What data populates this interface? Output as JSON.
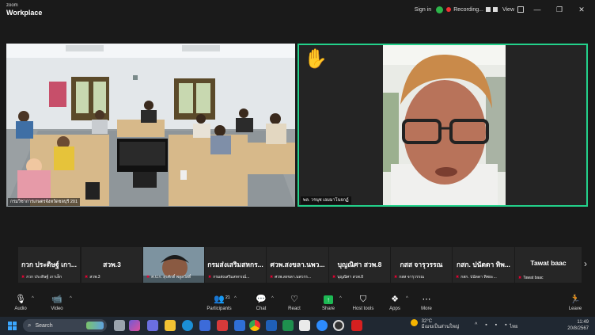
{
  "app": {
    "brand_line1": "zoom",
    "brand_line2": "Workplace"
  },
  "titlebar": {
    "signin": "Sign in",
    "recording": "Recording...",
    "view": "View"
  },
  "colors": {
    "active_speaker_border": "#23d18b",
    "muted_mic": "#e00033",
    "share_green": "#1db954",
    "leave_red": "#ff4d4d",
    "taskbar": "#202832"
  },
  "tiles": {
    "room_label": "กรมวิชาการเกษตรจังหวัดชลบุรี 201",
    "speaker_label": "พล. วรนุช เอมมาโนจกฏ์",
    "speaker_reaction": "✋"
  },
  "filmstrip": [
    {
      "name": "กวก ประดิษฐ์ เกา...",
      "sub": "กวก ประดิษฐ์ เกาเล็ก"
    },
    {
      "name": "สวพ.3",
      "sub": "สวพ.3"
    },
    {
      "name": "",
      "sub": "ศ.ป.ก. สุรศักดิ์ พลูสวัสดิ์"
    },
    {
      "name": "กรมส่งเสริมสหกร...",
      "sub": "กรมส่งเสริมสหกรณ์..."
    },
    {
      "name": "ศวพ.สงขลา.นพว...",
      "sub": "ศวพ.สงขลา.นพวรร..."
    },
    {
      "name": "บุญณิศา สวพ.8",
      "sub": "บุญณิศา สวพ.8"
    },
    {
      "name": "กสส จารุวรรณ",
      "sub": "กสส จารุวรรณ"
    },
    {
      "name": "กสก. ปนัดดา ทิพ...",
      "sub": "กสก. ปนัดดา ทิพยะ..."
    },
    {
      "name": "Tawat baac",
      "sub": "Tawat baac"
    }
  ],
  "toolbar": {
    "audio": "Audio",
    "video": "Video",
    "participants": "Participants",
    "participants_count": "21",
    "chat": "Chat",
    "react": "React",
    "share": "Share",
    "host_tools": "Host tools",
    "apps": "Apps",
    "more": "More",
    "leave": "Leave"
  },
  "taskbar": {
    "search_placeholder": "Search",
    "weather_temp": "32°C",
    "weather_desc": "มีเมฆเป็นส่วนใหญ่",
    "lang": "ไทย",
    "time": "11:49",
    "date": "20/8/2567"
  }
}
